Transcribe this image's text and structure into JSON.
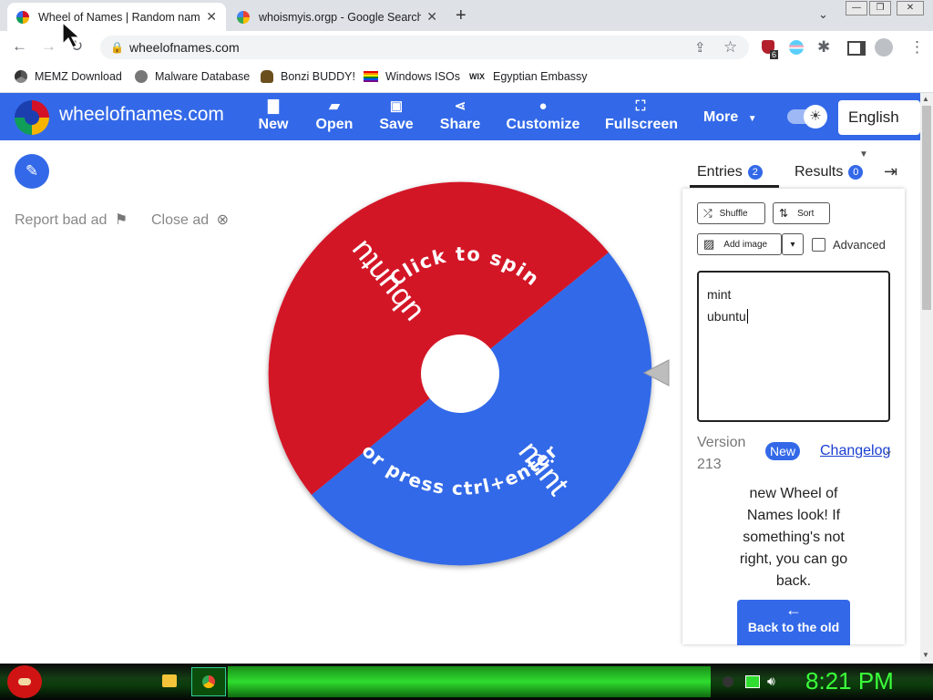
{
  "browser": {
    "tabs": [
      {
        "title": "Wheel of Names | Random name picker",
        "active": true
      },
      {
        "title": "whoismyis.orgp - Google Search",
        "active": false
      }
    ],
    "url": "wheelofnames.com",
    "extension_badge": "6",
    "bookmarks": [
      "MEMZ Download",
      "Malware Database",
      "Bonzi BUDDY!",
      "Windows ISOs",
      "Egyptian Embassy"
    ]
  },
  "app": {
    "brand": "wheelofnames.com",
    "nav": [
      {
        "label": "New",
        "icon": "file-icon"
      },
      {
        "label": "Open",
        "icon": "folder-icon"
      },
      {
        "label": "Save",
        "icon": "save-icon"
      },
      {
        "label": "Share",
        "icon": "share-icon"
      },
      {
        "label": "Customize",
        "icon": "palette-icon"
      },
      {
        "label": "Fullscreen",
        "icon": "fullscreen-icon"
      }
    ],
    "more_label": "More",
    "language": "English",
    "accent": "#3369e8"
  },
  "ads": {
    "report": "Report bad ad",
    "close": "Close ad"
  },
  "wheel": {
    "top_text": "Click to spin",
    "bottom_text": "or press ctrl+enter",
    "segments": [
      {
        "name": "ubuntu",
        "color": "#d31228"
      },
      {
        "name": "mint",
        "color": "#3369e8"
      }
    ]
  },
  "panel": {
    "entries_tab": "Entries",
    "entries_count": "2",
    "results_tab": "Results",
    "results_count": "0",
    "shuffle": "Shuffle",
    "sort": "Sort",
    "add_image": "Add image",
    "advanced": "Advanced",
    "entries": [
      "mint",
      "ubuntu"
    ],
    "version_label": "Version",
    "version_number": "213",
    "new_badge": "New",
    "changelog": "Changelog",
    "notice": "new Wheel of Names look! If something's not right, you can go back.",
    "back_button": "Back to the old"
  },
  "taskbar": {
    "clock": "8:21 PM"
  }
}
